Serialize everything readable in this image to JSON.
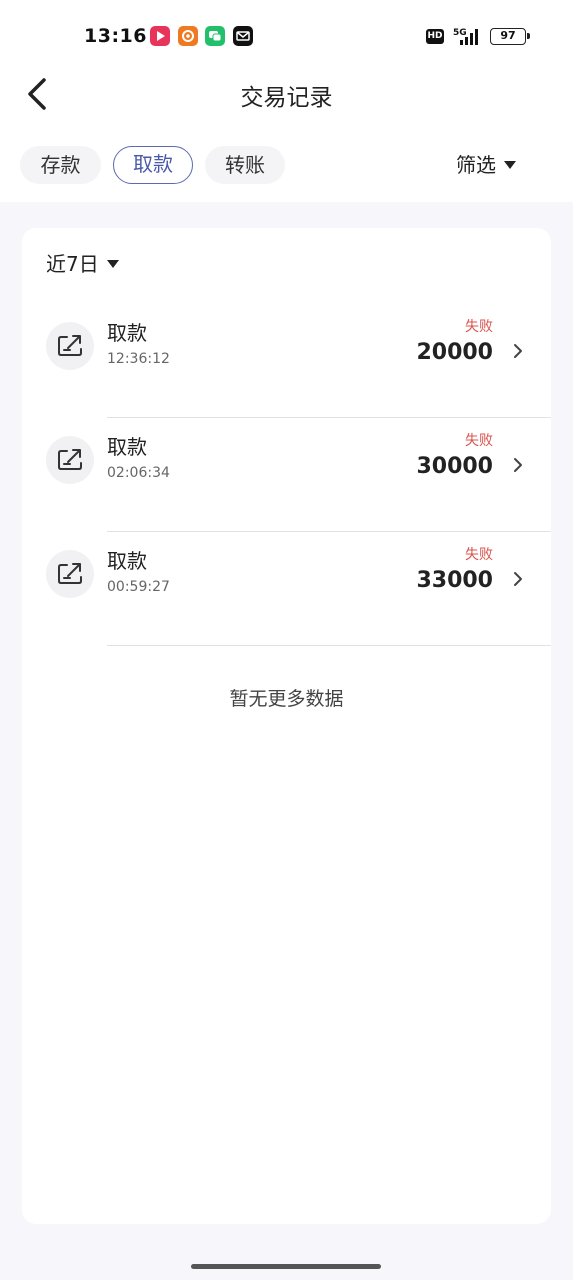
{
  "status_bar": {
    "time": "13:16",
    "hd": "HD",
    "network": "5G",
    "battery": "97",
    "icons": [
      "video-app-icon",
      "browser-app-icon",
      "chat-app-icon",
      "mail-app-icon"
    ]
  },
  "header": {
    "title": "交易记录",
    "back_icon": "chevron-left-icon"
  },
  "tabs": [
    {
      "label": "存款",
      "active": false
    },
    {
      "label": "取款",
      "active": true
    },
    {
      "label": "转账",
      "active": false
    }
  ],
  "filter": {
    "label": "筛选"
  },
  "period": {
    "label": "近7日"
  },
  "records": [
    {
      "title": "取款",
      "time": "12:36:12",
      "status": "失败",
      "amount": "20000"
    },
    {
      "title": "取款",
      "time": "02:06:34",
      "status": "失败",
      "amount": "30000"
    },
    {
      "title": "取款",
      "time": "00:59:27",
      "status": "失败",
      "amount": "33000"
    }
  ],
  "empty_text": "暂无更多数据",
  "colors": {
    "active_tab": "#4a5aa8",
    "failed": "#d9534f",
    "background": "#f6f6fb"
  }
}
